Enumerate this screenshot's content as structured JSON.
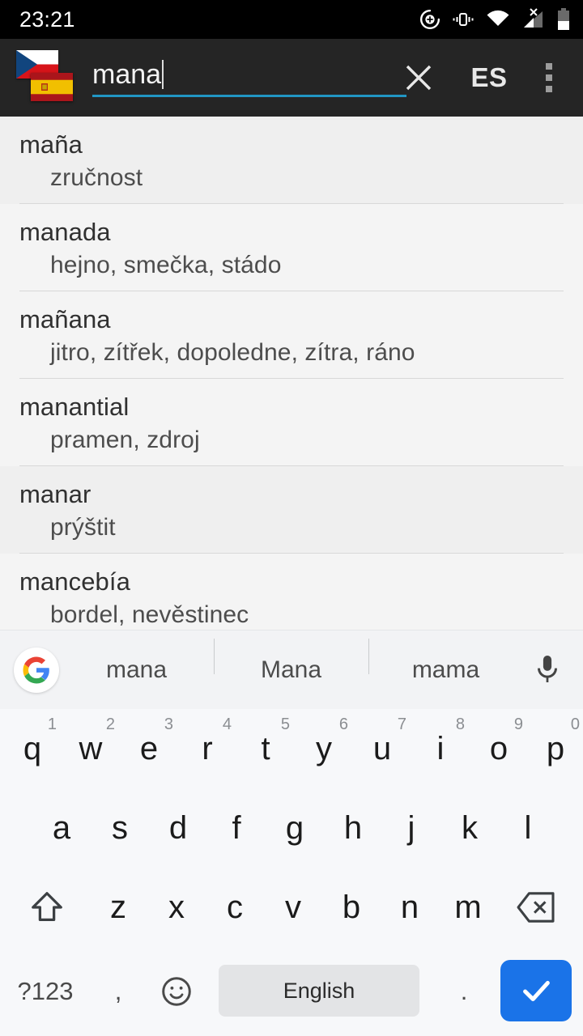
{
  "statusbar": {
    "time": "23:21",
    "icons": [
      "location-icon",
      "vibrate-icon",
      "wifi-icon",
      "no-signal-icon",
      "battery-icon"
    ]
  },
  "toolbar": {
    "flag_from": "czech-flag",
    "flag_to": "spanish-flag",
    "search_value": "mana",
    "search_placeholder": "",
    "clear_label": "clear-search",
    "language_label": "ES",
    "overflow_label": "more-options",
    "accent_color": "#2196c4",
    "background_color": "#252525"
  },
  "results": [
    {
      "term": "maña",
      "translation": "zručnost"
    },
    {
      "term": "manada",
      "translation": "hejno, smečka, stádo"
    },
    {
      "term": "mañana",
      "translation": "jitro, zítřek, dopoledne, zítra, ráno"
    },
    {
      "term": "manantial",
      "translation": "pramen, zdroj"
    },
    {
      "term": "manar",
      "translation": "prýštit"
    },
    {
      "term": "mancebía",
      "translation": "bordel, nevěstinec"
    }
  ],
  "partial_row": {
    "term": "manc"
  },
  "suggestions": {
    "logo": "google-logo",
    "items": [
      "mana",
      "Mana",
      "mama"
    ],
    "mic": "microphone-icon"
  },
  "keyboard": {
    "row1": [
      {
        "key": "q",
        "hint": "1"
      },
      {
        "key": "w",
        "hint": "2"
      },
      {
        "key": "e",
        "hint": "3"
      },
      {
        "key": "r",
        "hint": "4"
      },
      {
        "key": "t",
        "hint": "5"
      },
      {
        "key": "y",
        "hint": "6"
      },
      {
        "key": "u",
        "hint": "7"
      },
      {
        "key": "i",
        "hint": "8"
      },
      {
        "key": "o",
        "hint": "9"
      },
      {
        "key": "p",
        "hint": "0"
      }
    ],
    "row2": [
      {
        "key": "a"
      },
      {
        "key": "s"
      },
      {
        "key": "d"
      },
      {
        "key": "f"
      },
      {
        "key": "g"
      },
      {
        "key": "h"
      },
      {
        "key": "j"
      },
      {
        "key": "k"
      },
      {
        "key": "l"
      }
    ],
    "row3": [
      {
        "key": "z"
      },
      {
        "key": "x"
      },
      {
        "key": "c"
      },
      {
        "key": "v"
      },
      {
        "key": "b"
      },
      {
        "key": "n"
      },
      {
        "key": "m"
      }
    ],
    "shift": "shift-icon",
    "backspace": "backspace-icon",
    "symbols_label": "?123",
    "comma_label": ",",
    "emoji_label": "emoji-icon",
    "space_label": "English",
    "period_label": ".",
    "enter_label": "check-icon",
    "enter_color": "#1a73e8"
  }
}
